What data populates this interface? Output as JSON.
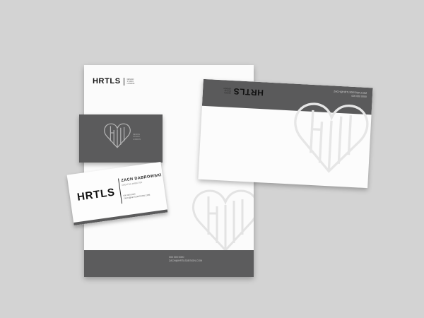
{
  "brand": {
    "wordmark": "HRTLS",
    "monogram": "HRTLS",
    "tagline_lines": [
      "DESIGN",
      "STUDIO",
      "LONDON"
    ]
  },
  "business_card": {
    "name": "ZACH DABROWSKI",
    "title": "CREATIVE DIRECTOR",
    "phone": "000 000 0000",
    "email": "ZACH@HRTLSDESIGN.COM"
  },
  "colors": {
    "charcoal": "#5b5b5c",
    "background": "#d3d3d3",
    "paper": "#fbfbfb",
    "ink": "#111111"
  },
  "icons": {
    "heart_monogram": "heart-monogram-icon"
  }
}
